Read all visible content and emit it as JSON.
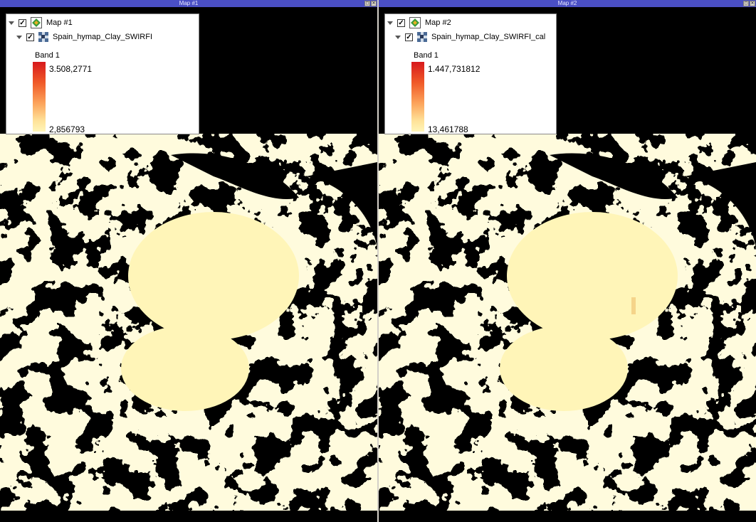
{
  "colors": {
    "titlebar": "#4a4fc4",
    "background": "#000000",
    "foreground": "#fff5b8",
    "ramp_top": "#d7191c",
    "ramp_bottom": "#fff5b8"
  },
  "map1": {
    "title": "Map #1",
    "tree_map_label": "Map #1",
    "layer_label": "Spain_hymap_Clay_SWIRFI",
    "band_label": "Band 1",
    "max_value": "3.508,2771",
    "min_value": "2,856793",
    "map_icon": "map-icon",
    "layer_icon": "raster-layer-icon"
  },
  "map2": {
    "title": "Map #2",
    "tree_map_label": "Map #2",
    "layer_label": "Spain_hymap_Clay_SWIRFI_cal",
    "band_label": "Band 1",
    "max_value": "1.447,731812",
    "min_value": "13,461788",
    "map_icon": "map-icon",
    "layer_icon": "raster-layer-icon"
  },
  "window_buttons": {
    "restore": "◻",
    "close": "✕"
  }
}
